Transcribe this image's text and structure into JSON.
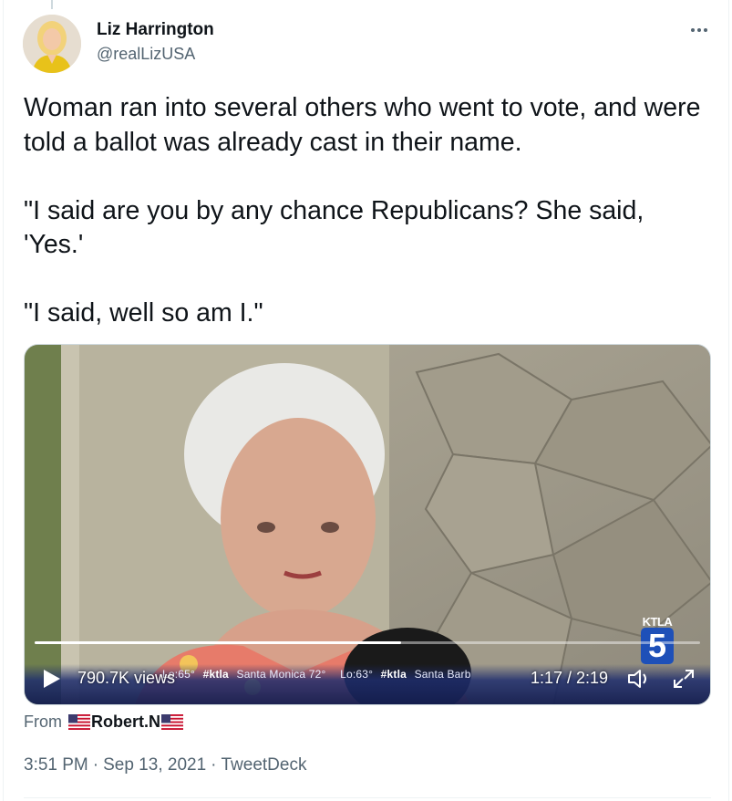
{
  "author": {
    "name": "Liz Harrington",
    "handle": "@realLizUSA"
  },
  "tweet": {
    "paragraphs": [
      "Woman ran into several others who went to vote, and were told a ballot was already cast in their name.",
      "\"I said are you by any chance Republicans? She said, 'Yes.'",
      "\"I said, well so am I.\""
    ]
  },
  "video": {
    "views": "790.7K views",
    "time": "1:17 / 2:19",
    "progress": 0.55,
    "logo_text": "KTLA",
    "logo_number": "5",
    "ticker": [
      "Lo:65°",
      "#ktla",
      "Santa Monica 72°",
      "Lo:63°",
      "#ktla",
      "Santa Barb"
    ]
  },
  "source": {
    "from_label": "From",
    "user": "Robert.N"
  },
  "meta": {
    "time": "3:51 PM",
    "date": "Sep 13, 2021",
    "client": "TweetDeck",
    "separator": "·"
  },
  "icons": {
    "more": "more-horizontal-icon",
    "play": "play-icon",
    "volume": "volume-icon",
    "fullscreen": "fullscreen-icon",
    "flag": "us-flag-icon"
  },
  "colors": {
    "text_primary": "#0f1419",
    "text_secondary": "#536471",
    "logo_blue": "#1e50b8"
  }
}
